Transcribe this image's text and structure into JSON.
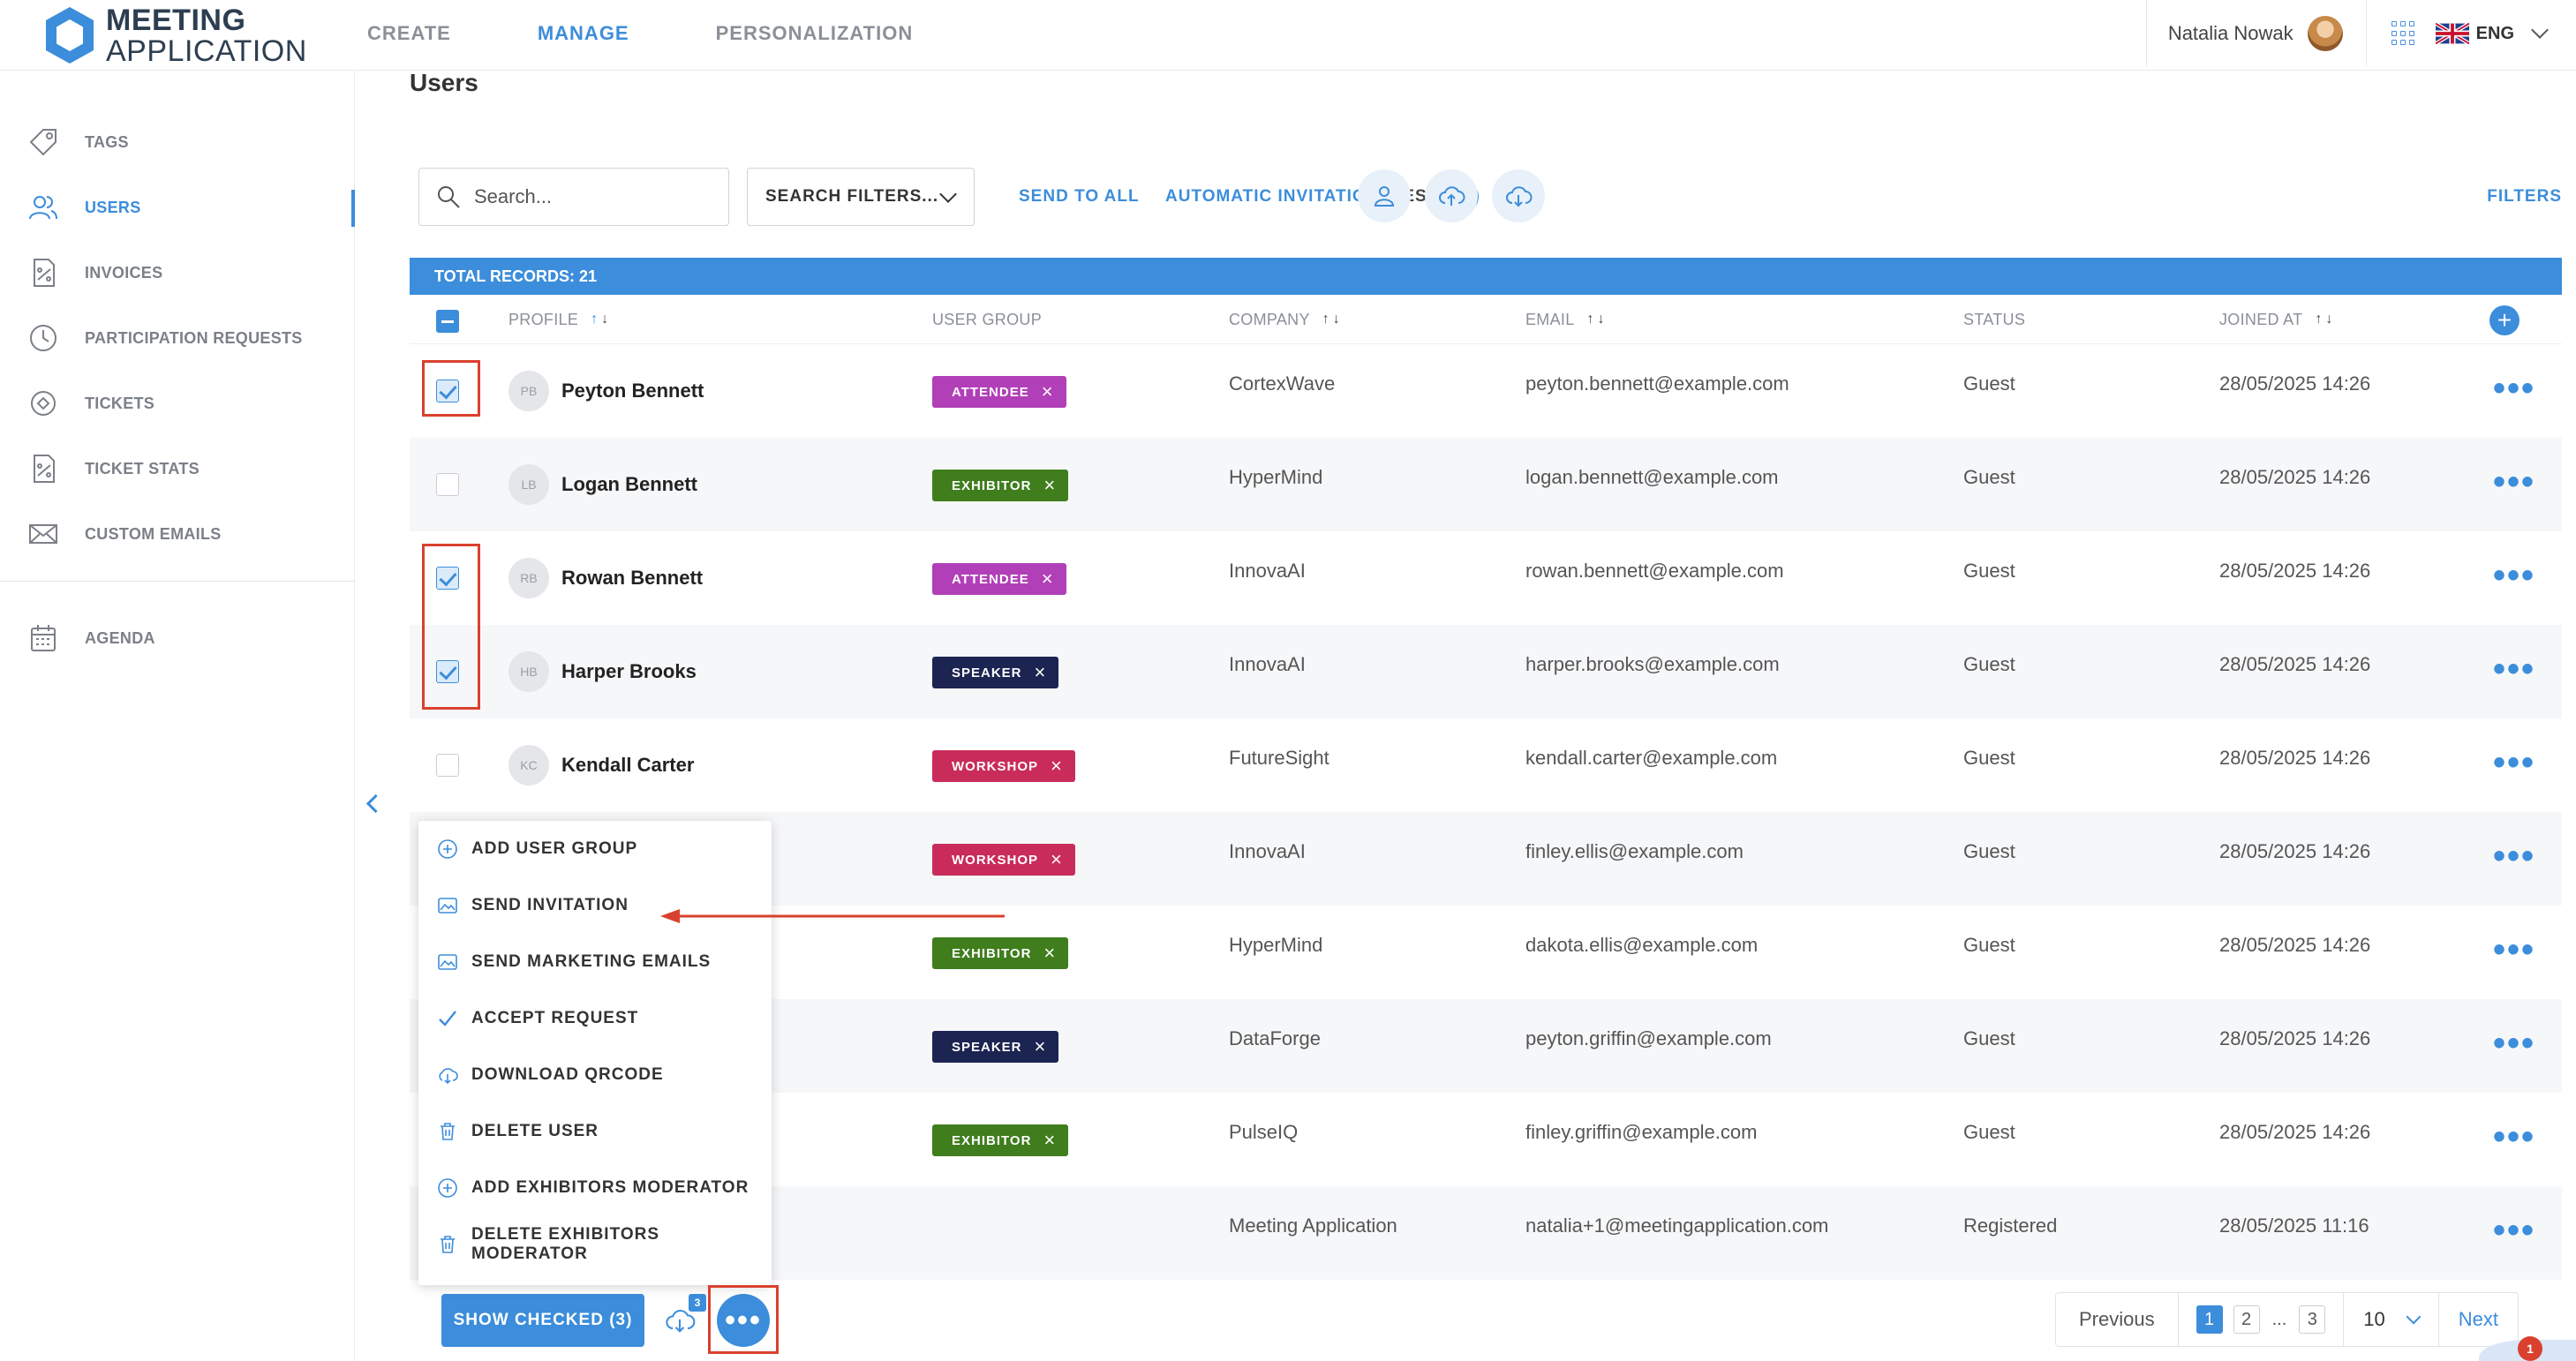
{
  "app": {
    "logo_line1": "MEETING",
    "logo_line2": "APPLICATION",
    "accent": "#3c8ddb"
  },
  "topnav": {
    "items": [
      "CREATE",
      "MANAGE",
      "PERSONALIZATION"
    ],
    "active": "MANAGE"
  },
  "topbar": {
    "user_name": "Natalia Nowak",
    "language": "ENG"
  },
  "sidebar": {
    "items": [
      {
        "label": "TAGS",
        "icon": "tag-icon"
      },
      {
        "label": "USERS",
        "icon": "users-icon",
        "active": true
      },
      {
        "label": "INVOICES",
        "icon": "invoice-icon"
      },
      {
        "label": "PARTICIPATION REQUESTS",
        "icon": "clock-icon"
      },
      {
        "label": "TICKETS",
        "icon": "ticket-icon"
      },
      {
        "label": "TICKET STATS",
        "icon": "stats-icon"
      },
      {
        "label": "CUSTOM EMAILS",
        "icon": "mail-icon"
      },
      {
        "label": "AGENDA",
        "icon": "calendar-icon"
      }
    ]
  },
  "page": {
    "title": "Users"
  },
  "toolbar": {
    "search_placeholder": "Search...",
    "search_filters": "SEARCH FILTERS...",
    "send_to_all": "SEND TO ALL",
    "auto_invitation_label": "AUTOMATIC INVITATION:",
    "auto_invitation_value": "YES",
    "help": "?",
    "filters": "FILTERS"
  },
  "table": {
    "total_records": "TOTAL RECORDS: 21",
    "columns": [
      "PROFILE",
      "USER GROUP",
      "COMPANY",
      "EMAIL",
      "STATUS",
      "JOINED AT"
    ],
    "rows": [
      {
        "initials": "PB",
        "name": "Peyton Bennett",
        "group": "ATTENDEE",
        "company": "CortexWave",
        "email": "peyton.bennett@example.com",
        "status": "Guest",
        "joined": "28/05/2025 14:26",
        "checked": true
      },
      {
        "initials": "LB",
        "name": "Logan Bennett",
        "group": "EXHIBITOR",
        "company": "HyperMind",
        "email": "logan.bennett@example.com",
        "status": "Guest",
        "joined": "28/05/2025 14:26",
        "checked": false
      },
      {
        "initials": "RB",
        "name": "Rowan Bennett",
        "group": "ATTENDEE",
        "company": "InnovaAI",
        "email": "rowan.bennett@example.com",
        "status": "Guest",
        "joined": "28/05/2025 14:26",
        "checked": true
      },
      {
        "initials": "HB",
        "name": "Harper Brooks",
        "group": "SPEAKER",
        "company": "InnovaAI",
        "email": "harper.brooks@example.com",
        "status": "Guest",
        "joined": "28/05/2025 14:26",
        "checked": true
      },
      {
        "initials": "KC",
        "name": "Kendall Carter",
        "group": "WORKSHOP",
        "company": "FutureSight",
        "email": "kendall.carter@example.com",
        "status": "Guest",
        "joined": "28/05/2025 14:26",
        "checked": false
      },
      {
        "group": "WORKSHOP",
        "company": "InnovaAI",
        "email": "finley.ellis@example.com",
        "status": "Guest",
        "joined": "28/05/2025 14:26"
      },
      {
        "group": "EXHIBITOR",
        "company": "HyperMind",
        "email": "dakota.ellis@example.com",
        "status": "Guest",
        "joined": "28/05/2025 14:26"
      },
      {
        "group": "SPEAKER",
        "company": "DataForge",
        "email": "peyton.griffin@example.com",
        "status": "Guest",
        "joined": "28/05/2025 14:26"
      },
      {
        "group": "EXHIBITOR",
        "company": "PulseIQ",
        "email": "finley.griffin@example.com",
        "status": "Guest",
        "joined": "28/05/2025 14:26"
      },
      {
        "group": "",
        "company": "Meeting Application",
        "email": "natalia+1@meetingapplication.com",
        "status": "Registered",
        "joined": "28/05/2025 11:16"
      }
    ]
  },
  "group_colors": {
    "ATTENDEE": "#b13fb8",
    "EXHIBITOR": "#3f7d1d",
    "SPEAKER": "#1c2452",
    "WORKSHOP": "#c92c5a"
  },
  "menu": {
    "items": [
      {
        "label": "ADD USER GROUP",
        "icon": "plus-circle-icon"
      },
      {
        "label": "SEND INVITATION",
        "icon": "image-mail-icon"
      },
      {
        "label": "SEND MARKETING EMAILS",
        "icon": "image-mail-icon"
      },
      {
        "label": "ACCEPT REQUEST",
        "icon": "check-icon"
      },
      {
        "label": "DOWNLOAD QRCODE",
        "icon": "cloud-download-icon"
      },
      {
        "label": "DELETE USER",
        "icon": "trash-icon"
      },
      {
        "label": "ADD EXHIBITORS MODERATOR",
        "icon": "plus-circle-icon"
      },
      {
        "label": "DELETE EXHIBITORS MODERATOR",
        "icon": "trash-icon"
      }
    ]
  },
  "bottom": {
    "show_checked": "SHOW CHECKED (3)",
    "download_badge": "3",
    "pagination": {
      "previous": "Previous",
      "pages": [
        "1",
        "2",
        "...",
        "3"
      ],
      "active_page": "1",
      "per_page": "10",
      "next": "Next"
    },
    "notifications": "1"
  }
}
